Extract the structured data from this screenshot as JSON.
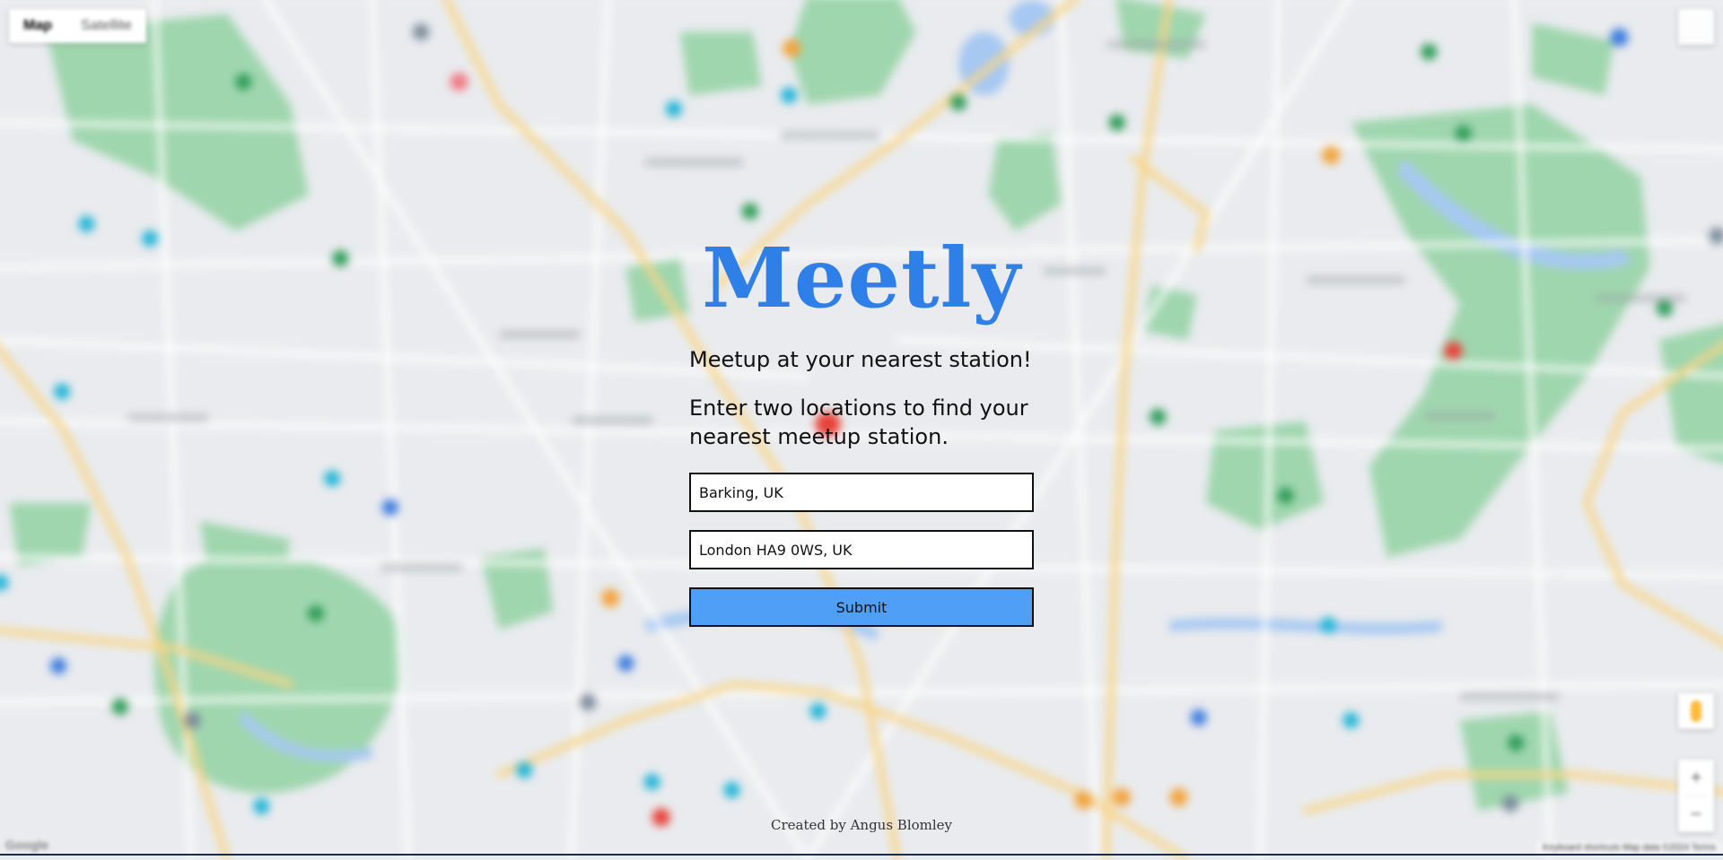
{
  "map": {
    "type_control": {
      "options": [
        "Map",
        "Satellite"
      ],
      "selected": "Map"
    },
    "zoom": {
      "in_label": "+",
      "out_label": "−"
    },
    "logo_text": "Google",
    "footer_text": "Keyboard shortcuts   Map data ©2024   Terms"
  },
  "app": {
    "logo": "Meetly",
    "tagline": "Meetup at your nearest station!",
    "instructions": "Enter two locations to find your nearest meetup station.",
    "location_one": {
      "value": "Barking, UK"
    },
    "location_two": {
      "value": "London HA9 0WS, UK"
    },
    "submit_label": "Submit",
    "credit": "Created by Angus Blomley"
  },
  "colors": {
    "brand": "#2e7fe8",
    "submit_bg": "#4f9ff6",
    "park": "#9fd6ae",
    "water": "#a6c8f2",
    "road_major": "#f9d586",
    "road_minor": "#ffffff",
    "land": "#e9ebee"
  },
  "icons": [
    "fullscreen-icon",
    "pegman-icon",
    "map-pin-icon"
  ]
}
